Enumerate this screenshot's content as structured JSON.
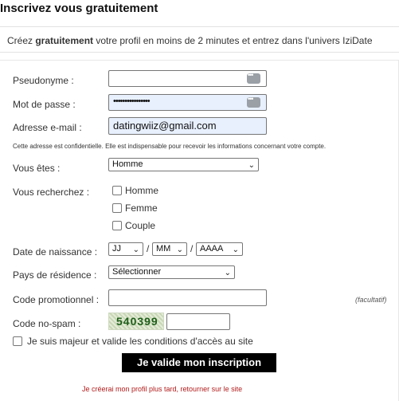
{
  "header": {
    "title": "Inscrivez vous gratuitement",
    "subtitle_before": "Créez ",
    "subtitle_bold": "gratuitement",
    "subtitle_after": " votre profil en moins de 2 minutes et entrez dans l'univers IziDate"
  },
  "form": {
    "pseudonyme": {
      "label": "Pseudonyme :",
      "value": ""
    },
    "password": {
      "label": "Mot de passe :",
      "value": "••••••••••••••••"
    },
    "email": {
      "label": "Adresse e-mail :",
      "value": "datingwiiz@gmail.com",
      "note": "Cette adresse est confidentielle. Elle est indispensable pour recevoir les informations concernant votre compte."
    },
    "vous_etes": {
      "label": "Vous êtes :",
      "selected": "Homme"
    },
    "recherchez": {
      "label": "Vous recherchez :",
      "options": [
        "Homme",
        "Femme",
        "Couple"
      ]
    },
    "date_naissance": {
      "label": "Date de naissance :",
      "jour": "JJ",
      "mois": "MM",
      "annee": "AAAA",
      "separator": "/"
    },
    "pays": {
      "label": "Pays de résidence :",
      "selected": "Sélectionner"
    },
    "code_promo": {
      "label": "Code promotionnel :",
      "value": "",
      "hint": "(facultatif)"
    },
    "code_nospam": {
      "label": "Code no-spam :",
      "captcha": "540399",
      "value": ""
    },
    "majeur_label": "Je suis majeur et valide les conditions d'accès au site",
    "submit_label": "Je valide mon inscription",
    "later_link": "Je créerai mon profil plus tard, retourner sur le site"
  },
  "colors": {
    "autofill_bg": "#e8f0fe",
    "submit_bg": "#000000",
    "link_red": "#b21b1b",
    "captcha_green": "#1f5f1a"
  }
}
